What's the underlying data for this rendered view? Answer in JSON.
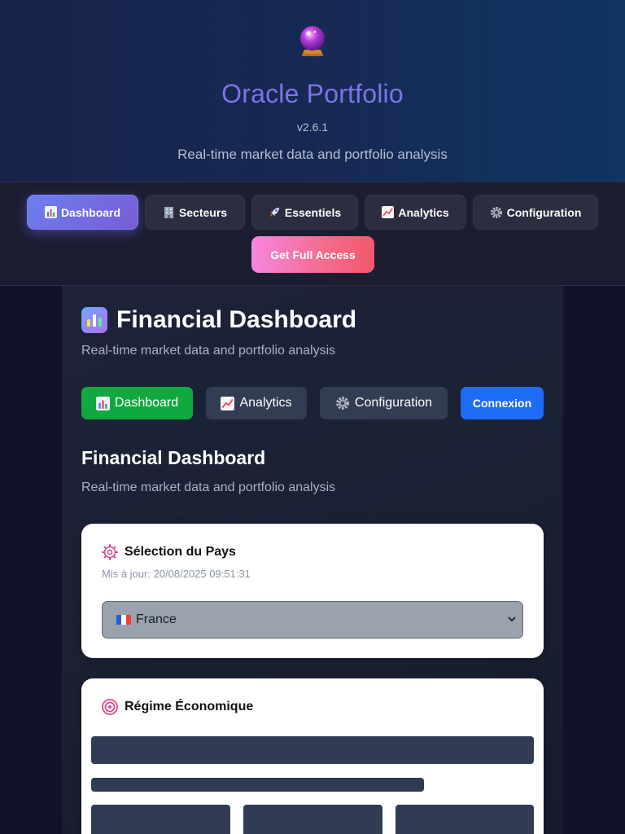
{
  "header": {
    "title": "Oracle Portfolio",
    "version": "v2.6.1",
    "subtitle": "Real-time market data and portfolio analysis",
    "logo_icon": "crystal-ball-icon"
  },
  "top_nav": {
    "items": [
      {
        "label": "Dashboard",
        "icon": "bar-chart-icon",
        "active": true
      },
      {
        "label": "Secteurs",
        "icon": "office-building-icon",
        "active": false
      },
      {
        "label": "Essentiels",
        "icon": "rocket-icon",
        "active": false
      },
      {
        "label": "Analytics",
        "icon": "trending-up-icon",
        "active": false
      },
      {
        "label": "Configuration",
        "icon": "gear-icon",
        "active": false
      }
    ],
    "cta_label": "Get Full Access"
  },
  "panel": {
    "title": "Financial Dashboard",
    "subtitle": "Real-time market data and portfolio analysis",
    "buttons": [
      {
        "label": "Dashboard",
        "icon": "bar-chart-icon",
        "color": "#0fa93f"
      },
      {
        "label": "Analytics",
        "icon": "trending-up-icon"
      },
      {
        "label": "Configuration",
        "icon": "gear-icon"
      },
      {
        "label": "Connexion",
        "color": "#1d6cf5"
      }
    ],
    "section_title": "Financial Dashboard",
    "section_subtitle": "Real-time market data and portfolio analysis"
  },
  "country_card": {
    "title": "Sélection du Pays",
    "icon": "gear-icon",
    "updated": "Mis à jour: 20/08/2025 09:51:31",
    "selected_country": "France",
    "flag_icon": "france-flag-icon"
  },
  "regime_card": {
    "title": "Régime Économique",
    "icon": "target-icon",
    "loading": true
  },
  "colors": {
    "accent_purple": "#7d74e6",
    "cta_pink": "#f46b8b",
    "success_green": "#0fa93f",
    "primary_blue": "#1d6cf5",
    "icon_pink": "#e0468f"
  }
}
